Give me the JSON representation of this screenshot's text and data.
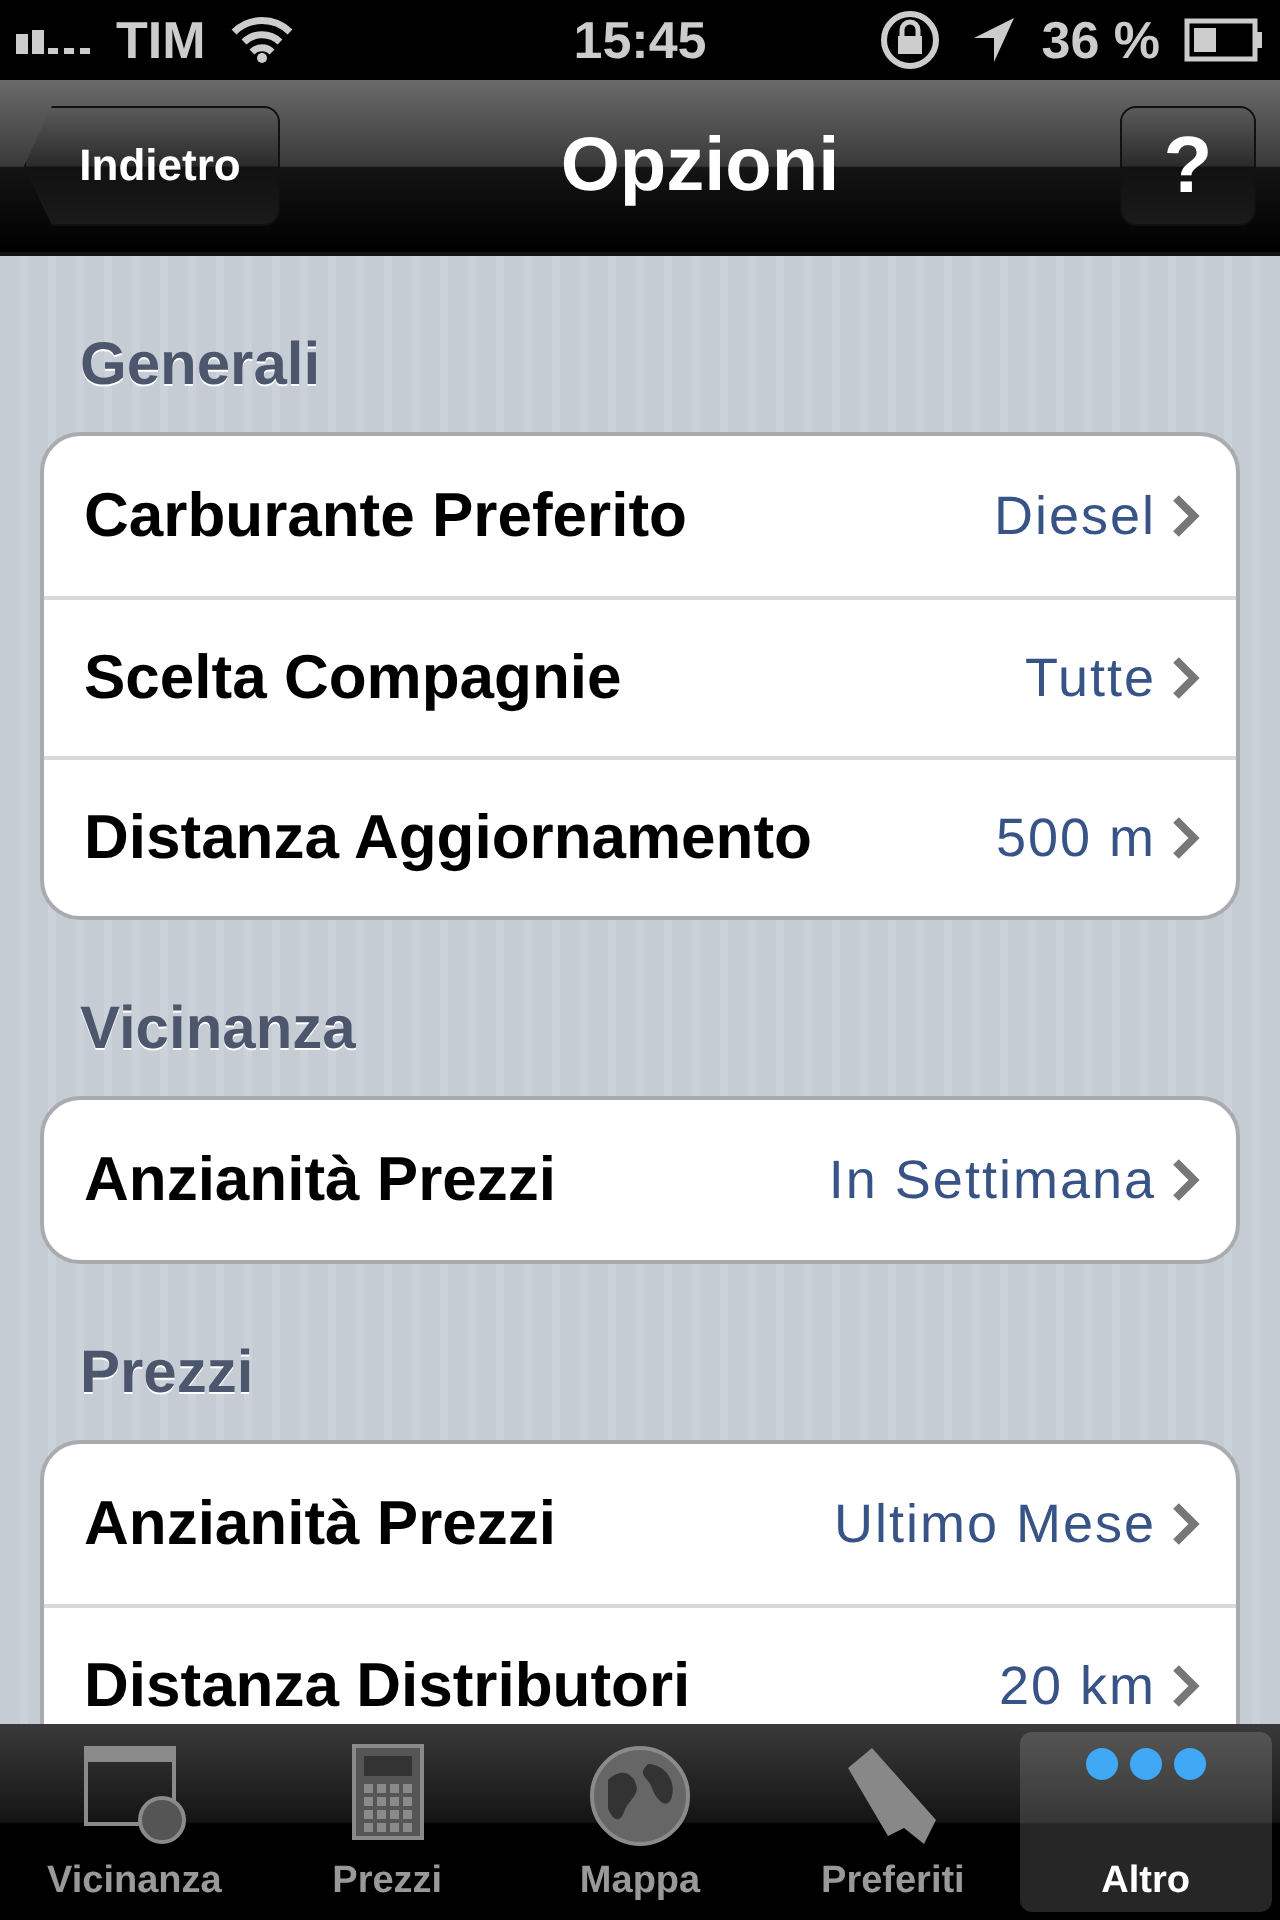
{
  "status_bar": {
    "carrier": "TIM",
    "time": "15:45",
    "battery": "36 %"
  },
  "nav_bar": {
    "back": "Indietro",
    "title": "Opzioni",
    "help": "?"
  },
  "sections": [
    {
      "header": "Generali",
      "rows": [
        {
          "label": "Carburante Preferito",
          "value": "Diesel"
        },
        {
          "label": "Scelta Compagnie",
          "value": "Tutte"
        },
        {
          "label": "Distanza Aggiornamento",
          "value": "500 m"
        }
      ]
    },
    {
      "header": "Vicinanza",
      "rows": [
        {
          "label": "Anzianità Prezzi",
          "value": "In Settimana"
        }
      ]
    },
    {
      "header": "Prezzi",
      "rows": [
        {
          "label": "Anzianità Prezzi",
          "value": "Ultimo Mese"
        },
        {
          "label": "Distanza Distributori",
          "value": "20 km"
        }
      ]
    }
  ],
  "tab_bar": [
    {
      "label": "Vicinanza",
      "kind": "window",
      "selected": false
    },
    {
      "label": "Prezzi",
      "kind": "calculator",
      "selected": false
    },
    {
      "label": "Mappa",
      "kind": "globe",
      "selected": false
    },
    {
      "label": "Preferiti",
      "kind": "bookmark",
      "selected": false
    },
    {
      "label": "Altro",
      "kind": "more",
      "selected": true
    }
  ]
}
